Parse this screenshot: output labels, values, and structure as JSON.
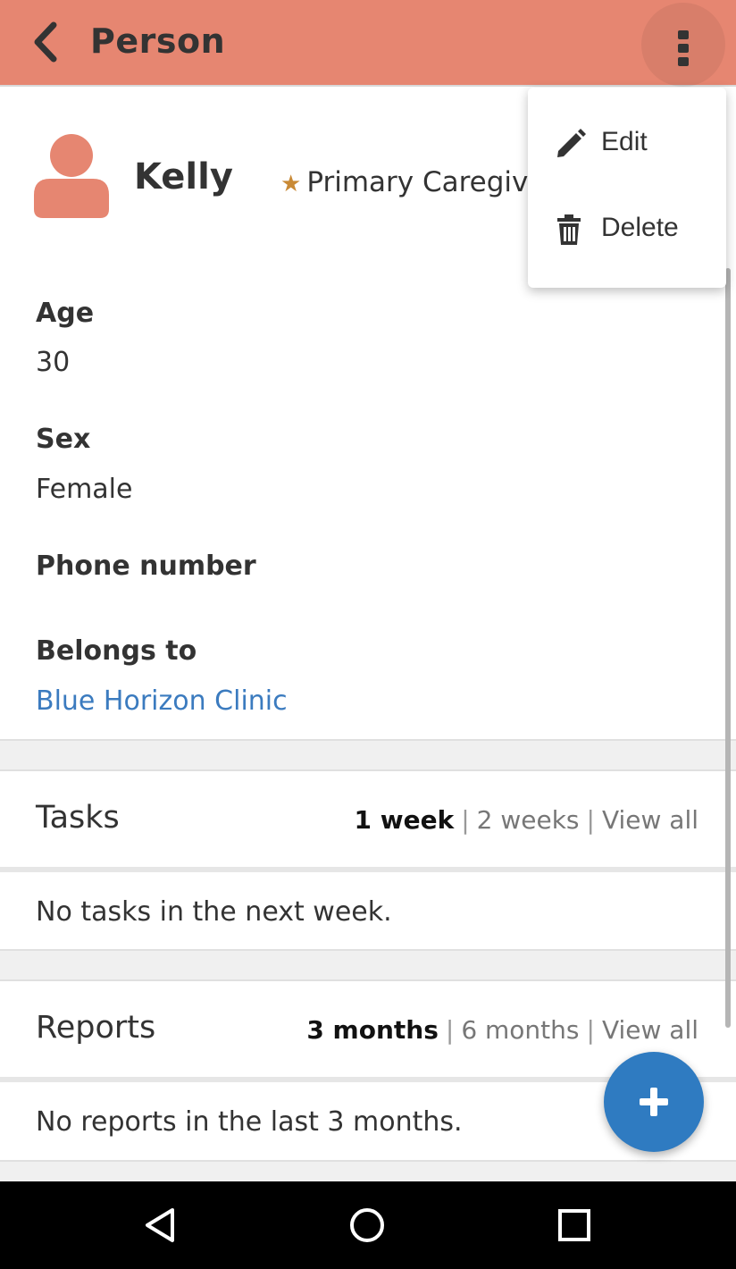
{
  "colors": {
    "app_bar": "#e68671",
    "accent_link": "#3b7bbf",
    "fab": "#2f7bc1",
    "star": "#c98a36"
  },
  "header": {
    "back_icon": "chevron-left-icon",
    "title": "Person",
    "overflow_icon": "more-vertical-icon"
  },
  "profile": {
    "avatar_icon": "person-icon",
    "name": "Kelly",
    "role_icon": "star-icon",
    "role": "Primary Caregiver"
  },
  "fields": [
    {
      "label": "Age",
      "value": "30"
    },
    {
      "label": "Sex",
      "value": "Female"
    },
    {
      "label": "Phone number",
      "value": ""
    },
    {
      "label": "Belongs to",
      "value": "Blue Horizon Clinic"
    }
  ],
  "tasks": {
    "title": "Tasks",
    "filters": [
      "1 week",
      "2 weeks",
      "View all"
    ],
    "empty": "No tasks in the next week."
  },
  "reports": {
    "title": "Reports",
    "filters": [
      "3 months",
      "6 months",
      "View all"
    ],
    "empty": "No reports in the last 3 months."
  },
  "menu": {
    "items": [
      {
        "label": "Edit",
        "icon": "pencil-icon"
      },
      {
        "label": "Delete",
        "icon": "trash-icon"
      }
    ]
  },
  "fab": {
    "icon": "plus-icon"
  },
  "system_nav": {
    "icons": [
      "back-triangle-icon",
      "home-circle-icon",
      "recents-square-icon"
    ]
  }
}
